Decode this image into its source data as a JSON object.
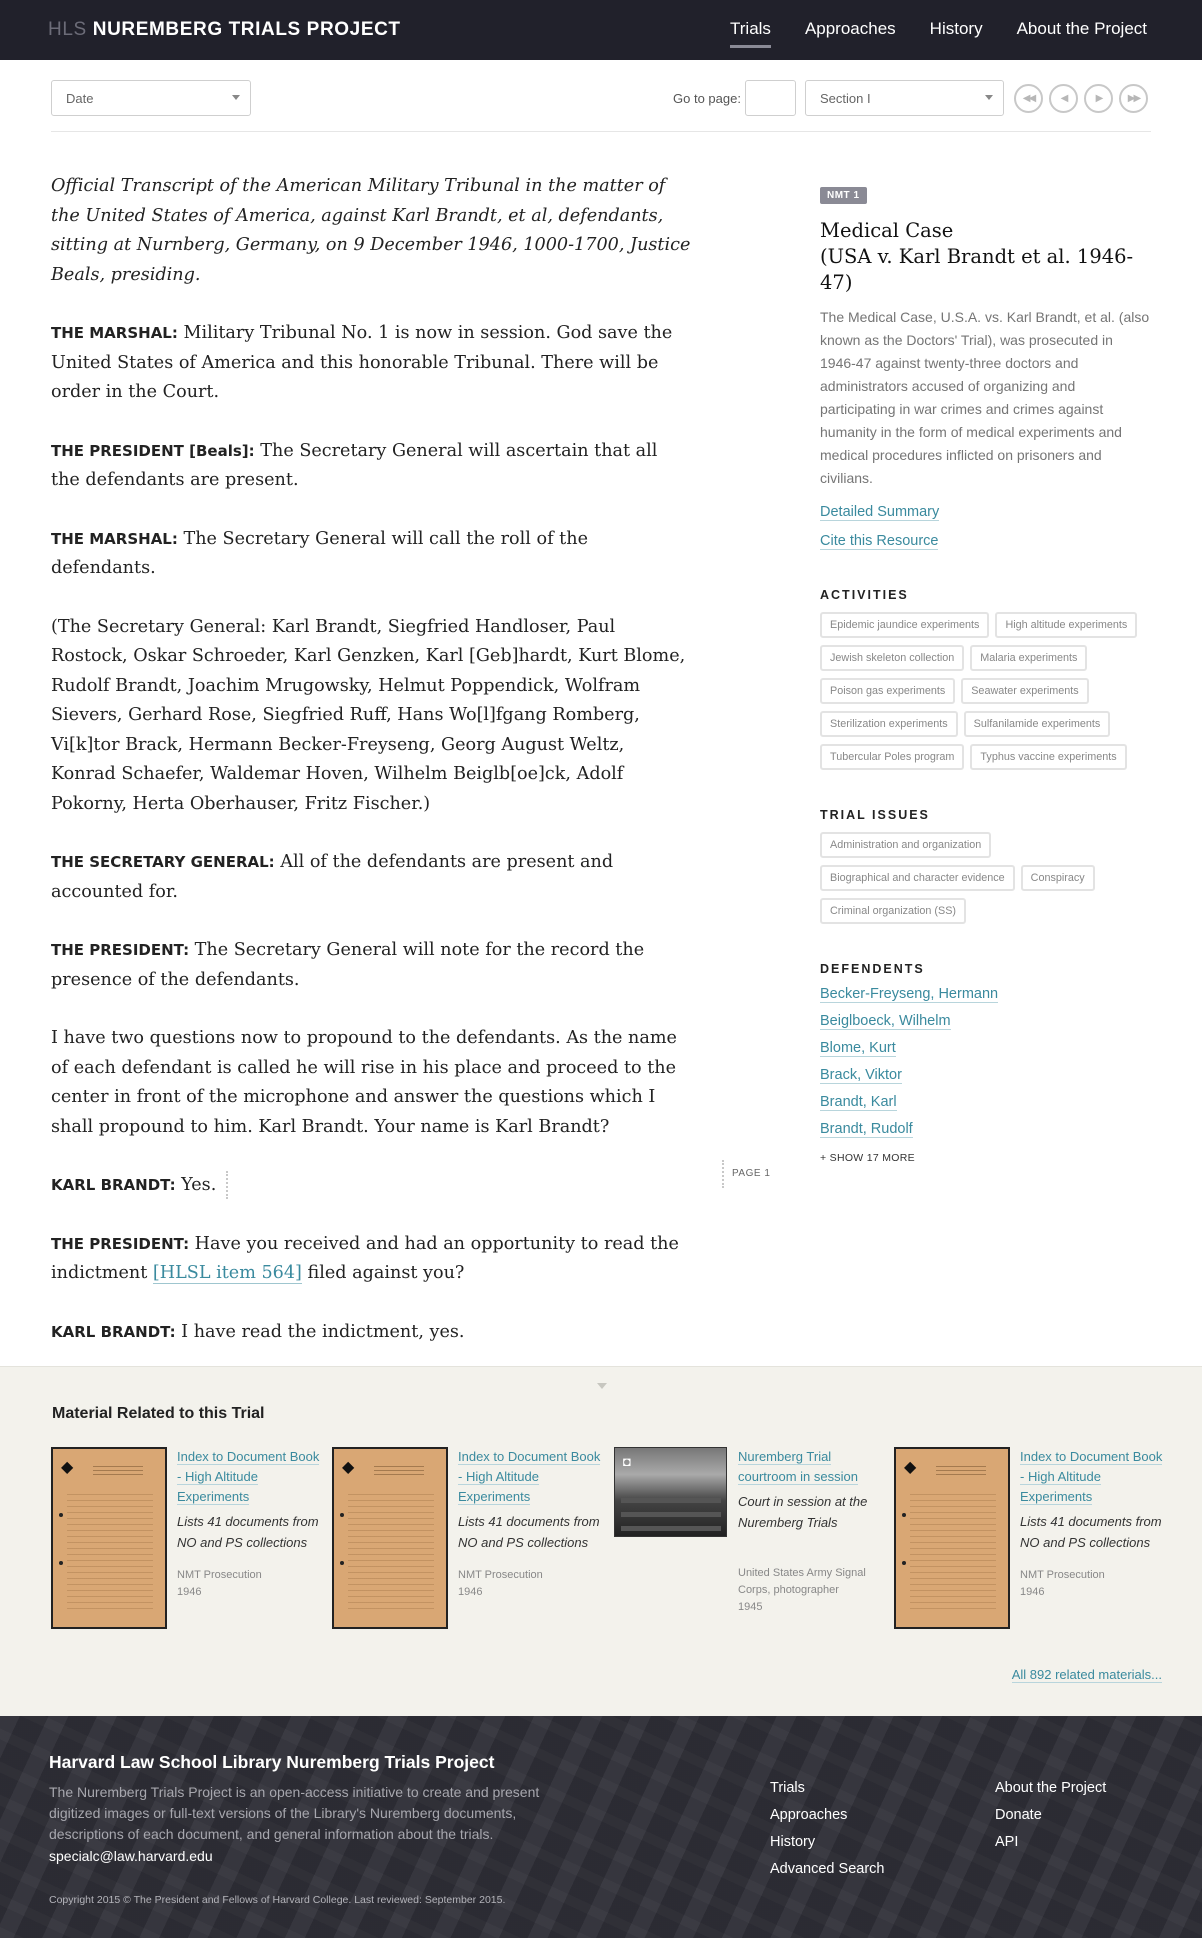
{
  "header": {
    "brand_prefix": "HLS",
    "brand_name": "NUREMBERG TRIALS PROJECT",
    "nav": [
      "Trials",
      "Approaches",
      "History",
      "About the Project"
    ]
  },
  "toolbar": {
    "date_select": "Date",
    "goto_label": "Go to page:",
    "goto_value": "",
    "section_select": "Section I",
    "pager": [
      "first",
      "previous",
      "next",
      "last"
    ]
  },
  "transcript": {
    "intro": "Official Transcript of the American Military Tribunal in the matter of the United States of America, against Karl Brandt, et al, defendants, sitting at Nurnberg, Germany, on 9 December 1946, 1000-1700, Justice Beals, presiding.",
    "entries": [
      {
        "speaker": "THE MARSHAL:",
        "text": " Military Tribunal No. 1 is now in session. God save the United States of America and this honorable Tribunal. There will be order in the Court."
      },
      {
        "speaker": "THE PRESIDENT [Beals]:",
        "text": " The Secretary General will ascertain that all the defendants are present."
      },
      {
        "speaker": "THE MARSHAL:",
        "text": " The Secretary General will call the roll of the defendants."
      },
      {
        "speaker": "",
        "text": "(The Secretary General: Karl Brandt, Siegfried Handloser, Paul Rostock, Oskar Schroeder, Karl Genzken, Karl [Geb]hardt, Kurt Blome, Rudolf Brandt, Joachim Mrugowsky, Helmut Poppendick, Wolfram Sievers, Gerhard Rose, Siegfried Ruff, Hans Wo[l]fgang Romberg, Vi[k]tor Brack, Hermann Becker-Freyseng, Georg August Weltz, Konrad Schaefer, Waldemar Hoven, Wilhelm Beiglb[oe]ck, Adolf Pokorny, Herta Oberhauser, Fritz Fischer.)"
      },
      {
        "speaker": "THE SECRETARY GENERAL:",
        "text": " All of the defendants are present and accounted for."
      },
      {
        "speaker": "THE PRESIDENT:",
        "text": " The Secretary General will note for the record the presence of the defendants."
      },
      {
        "speaker": "",
        "text": "I have two questions now to propound to the defendants. As the name of each defendant is called he will rise in his place and proceed to the center in front of the microphone and answer the questions which I shall propound to him. Karl Brandt. Your name is Karl Brandt?"
      },
      {
        "speaker": "KARL BRANDT:",
        "text": " Yes."
      },
      {
        "speaker": "THE PRESIDENT:",
        "text_before": " Have you received and had an opportunity to read the indictment ",
        "link": "[HLSL item 564]",
        "text_after": " filed against you?"
      },
      {
        "speaker": "KARL BRANDT:",
        "text": " I have read the indictment, yes."
      }
    ],
    "page_marker": "PAGE 1"
  },
  "sidebar": {
    "badge": "NMT 1",
    "title_line1": "Medical Case",
    "title_line2": "(USA v. Karl Brandt et al. 1946-47)",
    "description": "The Medical Case, U.S.A. vs. Karl Brandt, et al. (also known as the Doctors' Trial), was prosecuted in 1946-47 against twenty-three doctors and administrators accused of organizing and participating in war crimes and crimes against humanity in the form of medical experiments and medical procedures inflicted on prisoners and civilians.",
    "links": [
      "Detailed Summary",
      "Cite this Resource"
    ],
    "activities_heading": "ACTIVITIES",
    "activities": [
      "Epidemic jaundice experiments",
      "High altitude experiments",
      "Jewish skeleton collection",
      "Malaria experiments",
      "Poison gas experiments",
      "Seawater experiments",
      "Sterilization experiments",
      "Sulfanilamide experiments",
      "Tubercular Poles program",
      "Typhus vaccine experiments"
    ],
    "issues_heading": "TRIAL ISSUES",
    "issues": [
      "Administration and organization",
      "Biographical and character evidence",
      "Conspiracy",
      "Criminal organization (SS)"
    ],
    "defendants_heading": "DEFENDENTS",
    "defendants": [
      "Becker-Freyseng, Hermann",
      "Beiglboeck, Wilhelm",
      "Blome, Kurt",
      "Brack, Viktor",
      "Brandt, Karl",
      "Brandt, Rudolf"
    ],
    "show_more": "+ SHOW 17 MORE"
  },
  "related": {
    "heading": "Material Related to this Trial",
    "items": [
      {
        "title": "Index to Document Book - High Altitude Experiments",
        "desc": "Lists 41 documents from NO and PS collections",
        "meta1": "NMT Prosecution",
        "meta2": "1946",
        "kind": "document"
      },
      {
        "title": "Index to Document Book - High Altitude Experiments",
        "desc": "Lists 41 documents from NO and PS collections",
        "meta1": "NMT Prosecution",
        "meta2": "1946",
        "kind": "document"
      },
      {
        "title": "Nuremberg Trial courtroom in session",
        "desc": "Court in session at the Nuremberg Trials",
        "meta1": "United States Army Signal Corps,  photographer",
        "meta2": "1945",
        "kind": "photo"
      },
      {
        "title": "Index to Document Book - High Altitude Experiments",
        "desc": "Lists 41 documents from NO and PS collections",
        "meta1": "NMT Prosecution",
        "meta2": "1946",
        "kind": "document"
      }
    ],
    "all_link": "All 892 related materials..."
  },
  "footer": {
    "title": "Harvard Law School Library Nuremberg Trials Project",
    "description": "The Nuremberg Trials Project is an open-access initiative to create and present digitized images or full-text versions of the Library's Nuremberg documents, descriptions of each document, and general information about the trials.",
    "email": "specialc@law.harvard.edu",
    "col1": [
      "Trials",
      "Approaches",
      "History",
      "Advanced Search"
    ],
    "col2": [
      "About the Project",
      "Donate",
      "API"
    ],
    "copyright": "Copyright 2015 © The President and Fellows of Harvard College. Last reviewed: September 2015."
  },
  "colors": {
    "header_bg": "#21212b",
    "link": "#3a8a9e",
    "related_bg": "#f3f2ec",
    "footer_bg": "#2f2f37"
  }
}
